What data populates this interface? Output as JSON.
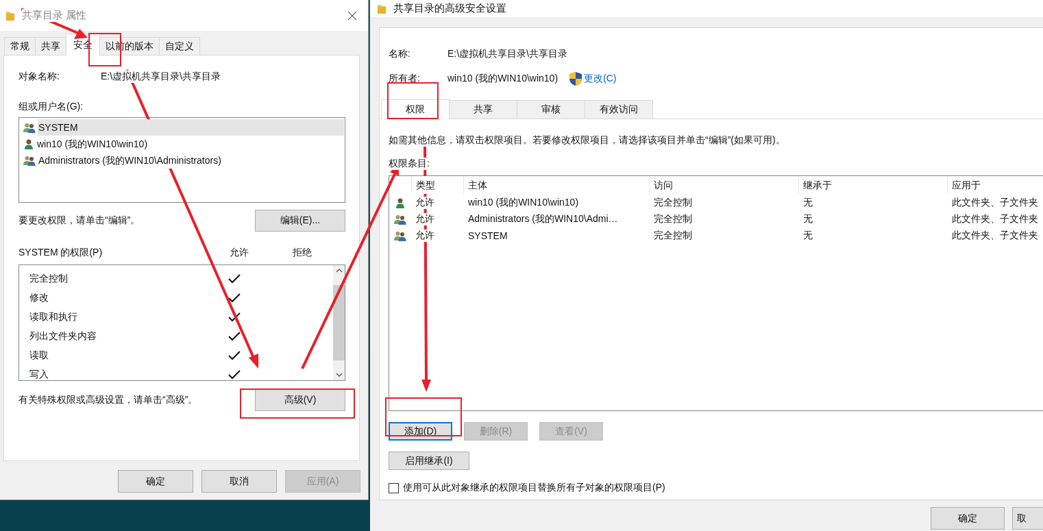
{
  "left_dialog": {
    "title": "共享目录 属性",
    "tabs": [
      {
        "label": "常规",
        "selected": false
      },
      {
        "label": "共享",
        "selected": false
      },
      {
        "label": "安全",
        "selected": true
      },
      {
        "label": "以前的版本",
        "selected": false
      },
      {
        "label": "自定义",
        "selected": false
      }
    ],
    "object_name": {
      "label": "对象名称:",
      "value": "E:\\虚拟机共享目录\\共享目录"
    },
    "users": {
      "label": "组或用户名(G):",
      "items": [
        {
          "name": "SYSTEM",
          "kind": "group",
          "selected": true
        },
        {
          "name": "win10 (我的WIN10\\win10)",
          "kind": "user",
          "selected": false
        },
        {
          "name": "Administrators (我的WIN10\\Administrators)",
          "kind": "group",
          "selected": false
        }
      ]
    },
    "edit_hint": "要更改权限，请单击“编辑”。",
    "edit_button": {
      "label": "编辑(E)...",
      "disabled": false
    },
    "permissions": {
      "label": "SYSTEM 的权限(P)",
      "allow_header": "允许",
      "deny_header": "拒绝",
      "items": [
        {
          "name": "完全控制",
          "allow": true,
          "deny": false
        },
        {
          "name": "修改",
          "allow": true,
          "deny": false
        },
        {
          "name": "读取和执行",
          "allow": true,
          "deny": false
        },
        {
          "name": "列出文件夹内容",
          "allow": true,
          "deny": false
        },
        {
          "name": "读取",
          "allow": true,
          "deny": false
        },
        {
          "name": "写入",
          "allow": true,
          "deny": false
        }
      ]
    },
    "advanced_hint": "有关特殊权限或高级设置，请单击“高级”。",
    "advanced_button": {
      "label": "高级(V)",
      "disabled": false
    },
    "buttons": [
      {
        "label": "确定",
        "disabled": false
      },
      {
        "label": "取消",
        "disabled": false
      },
      {
        "label": "应用(A)",
        "disabled": true
      }
    ]
  },
  "right_dialog": {
    "title": "共享目录的高级安全设置",
    "name": {
      "label": "名称:",
      "value": "E:\\虚拟机共享目录\\共享目录"
    },
    "owner": {
      "label": "所有者:",
      "value": "win10 (我的WIN10\\win10)",
      "link": "更改(C)"
    },
    "tabs": [
      {
        "label": "权限",
        "selected": true
      },
      {
        "label": "共享",
        "selected": false
      },
      {
        "label": "审核",
        "selected": false
      },
      {
        "label": "有效访问",
        "selected": false
      }
    ],
    "info_text": "如需其他信息，请双击权限项目。若要修改权限项目，请选择该项目并单击“编辑”(如果可用)。",
    "entries_label": "权限条目:",
    "table": {
      "columns": [
        "类型",
        "主体",
        "访问",
        "继承于",
        "应用于"
      ],
      "rows": [
        {
          "kind": "user",
          "type": "允许",
          "principal": "win10 (我的WIN10\\win10)",
          "access": "完全控制",
          "inherited_from": "无",
          "applies_to": "此文件夹、子文件夹"
        },
        {
          "kind": "group",
          "type": "允许",
          "principal": "Administrators (我的WIN10\\Admi…",
          "access": "完全控制",
          "inherited_from": "无",
          "applies_to": "此文件夹、子文件夹"
        },
        {
          "kind": "group",
          "type": "允许",
          "principal": "SYSTEM",
          "access": "完全控制",
          "inherited_from": "无",
          "applies_to": "此文件夹、子文件夹"
        }
      ]
    },
    "action_buttons": [
      {
        "label": "添加(D)",
        "disabled": false,
        "focused": true
      },
      {
        "label": "删除(R)",
        "disabled": true,
        "focused": false
      },
      {
        "label": "查看(V)",
        "disabled": true,
        "focused": false
      }
    ],
    "inherit_button": {
      "label": "启用继承(I)",
      "disabled": false
    },
    "replace_checkbox": {
      "label": "使用可从此对象继承的权限项目替换所有子对象的权限项目(P)",
      "checked": false
    },
    "buttons": [
      {
        "label": "确定",
        "disabled": false
      },
      {
        "label": "取",
        "disabled": false
      }
    ]
  }
}
